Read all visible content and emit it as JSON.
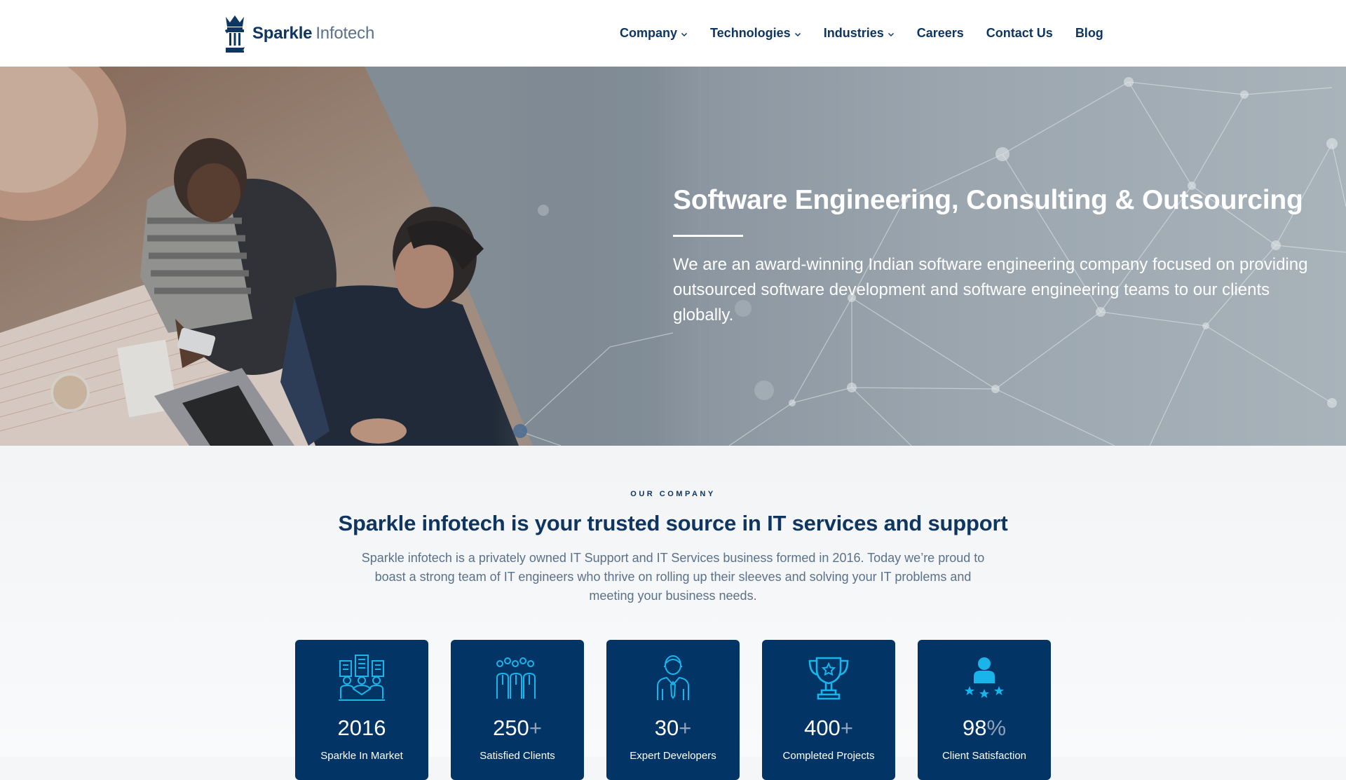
{
  "header": {
    "logo": {
      "word1": "Sparkle",
      "word2": "Infotech",
      "icon": "crown-pillar-logo-icon"
    },
    "nav": [
      {
        "label": "Company",
        "has_dropdown": true
      },
      {
        "label": "Technologies",
        "has_dropdown": true
      },
      {
        "label": "Industries",
        "has_dropdown": true
      },
      {
        "label": "Careers",
        "has_dropdown": false
      },
      {
        "label": "Contact Us",
        "has_dropdown": false
      },
      {
        "label": "Blog",
        "has_dropdown": false
      }
    ]
  },
  "hero": {
    "title": "Software Engineering, Consulting & Outsourcing",
    "description": "We are an award-winning Indian software engineering company focused on providing outsourced software development and software engineering teams to our clients globally.",
    "image": "two people working at a cafe table with laptop and network-node overlay"
  },
  "company": {
    "eyebrow": "OUR COMPANY",
    "title": "Sparkle infotech is your trusted source in IT services and support",
    "text": "Sparkle infotech is a privately owned IT Support and IT Services business formed in 2016. Today we’re proud to boast a strong team of IT engineers who thrive on rolling up their sleeves and solving your IT problems and meeting your business needs.",
    "stats": [
      {
        "icon": "city-team-icon",
        "value": "2016",
        "suffix": "",
        "label": "Sparkle In Market"
      },
      {
        "icon": "group-people-icon",
        "value": "250",
        "suffix": "+",
        "label": "Satisfied Clients"
      },
      {
        "icon": "developer-icon",
        "value": "30",
        "suffix": "+",
        "label": "Expert Developers"
      },
      {
        "icon": "trophy-icon",
        "value": "400",
        "suffix": "+",
        "label": "Completed Projects"
      },
      {
        "icon": "user-rating-icon",
        "value": "98",
        "suffix": "%",
        "label": "Client Satisfaction"
      }
    ]
  },
  "colors": {
    "brand_navy": "#0f3561",
    "card_bg": "#023466",
    "icon_cyan": "#19b5ea",
    "muted_text": "#5b7189"
  }
}
